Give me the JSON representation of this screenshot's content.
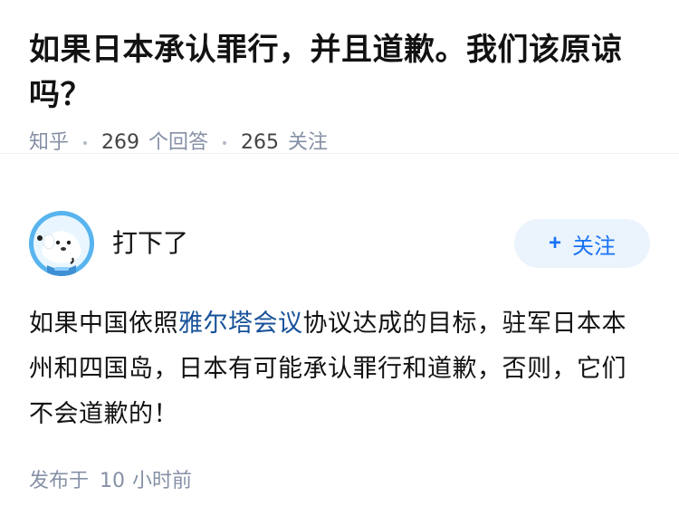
{
  "question": {
    "title": "如果日本承认罪行，并且道歉。我们该原谅吗？",
    "source": "知乎",
    "answer_count": "269",
    "answer_label": "个回答",
    "follower_count": "265",
    "follower_label": "关注"
  },
  "answer": {
    "author_name": "打下了",
    "avatar_icon": "avatar-icon",
    "follow_label": "关注",
    "follow_icon": "plus-icon",
    "body_prefix": "如果中国依照",
    "body_link": "雅尔塔会议",
    "body_suffix": "协议达成的目标，驻军日本本州和四国岛，日本有可能承认罪行和道歉，否则，它们不会道歉的！",
    "published_label": "发布于",
    "published_value": "10",
    "published_unit": "小时前"
  },
  "colors": {
    "accent": "#1772f6",
    "follow_bg": "#ebf4fd",
    "link": "#175199",
    "meta": "#8590a6"
  }
}
